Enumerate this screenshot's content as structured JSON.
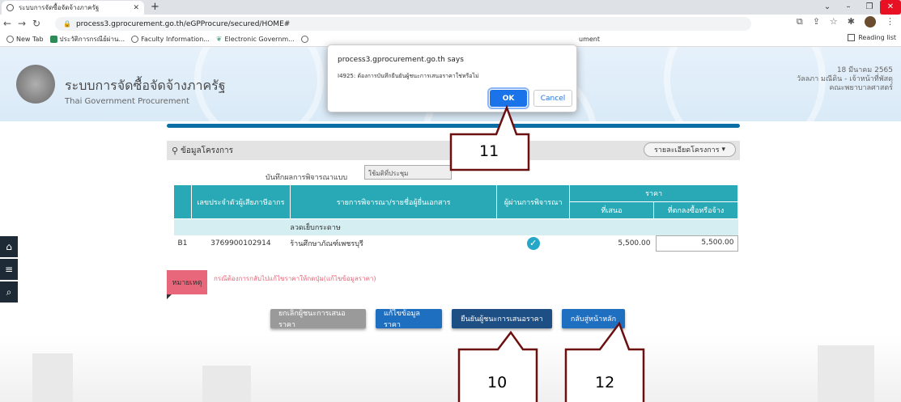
{
  "browser": {
    "tab_title": "ระบบการจัดซื้อจัดจ้างภาครัฐ",
    "url": "process3.gprocurement.go.th/eGPProcure/secured/HOME#",
    "bookmarks": [
      "New Tab",
      "ประวัติการกรณีย์ผ่าน...",
      "Faculty Information...",
      "Electronic Governm..."
    ],
    "bookmark_trunc": "ument",
    "reading_list": "Reading list"
  },
  "header": {
    "title_th": "ระบบการจัดซื้อจัดจ้างภาครัฐ",
    "title_en": "Thai Government Procurement",
    "date": "18 มีนาคม 2565",
    "user": "วัลลภา มณีดิน - เจ้าหน้าที่พัสดุ",
    "org": "คณะพยาบาลศาสตร์"
  },
  "panel": {
    "title": "ข้อมูลโครงการ",
    "detail_dropdown": "รายละเอียดโครงการ",
    "method_label": "บันทึกผลการพิจารณาแบบ",
    "method_value": "ใช้มติที่ประชุม"
  },
  "table": {
    "headers": {
      "tax_id": "เลขประจำตัวผู้เสียภาษีอากร",
      "items": "รายการพิจารณา/รายชื่อผู้ยื่นเอกสาร",
      "passed": "ผู้ผ่านการพิจารณา",
      "price": "ราคา",
      "offered": "ที่เสนอ",
      "agreed": "ที่ตกลงซื้อหรือจ้าง"
    },
    "group_label": "ลวดเย็บกระดาษ",
    "rows": [
      {
        "code": "B1",
        "tax_id": "3769900102914",
        "name": "ร้านศึกษาภัณฑ์เพชรบุรี",
        "offered": "5,500.00",
        "agreed": "5,500.00"
      }
    ]
  },
  "note": {
    "tag": "หมายเหตุ",
    "text": "กรณีต้องการกลับไปแก้ไขราคาให้กดปุ่ม(แก้ไขข้อมูลราคา)"
  },
  "buttons": {
    "cancel_winner": "ยกเลิกผู้ชนะการเสนอราคา",
    "edit_price": "แก้ไขข้อมูลราคา",
    "confirm_winner": "ยืนยันผู้ชนะการเสนอราคา",
    "back_home": "กลับสู่หน้าหลัก"
  },
  "dialog": {
    "title": "process3.gprocurement.go.th says",
    "message": "I4925: ต้องการบันทึกยืนยันผู้ชนะการเสนอราคาใช่หรือไม่",
    "ok": "OK",
    "cancel": "Cancel"
  },
  "callouts": {
    "c11": "11",
    "c10": "10",
    "c12": "12"
  },
  "colors": {
    "teal_header": "#29a9b5",
    "accent_blue": "#1f6fc0",
    "note_red": "#e8677a"
  }
}
